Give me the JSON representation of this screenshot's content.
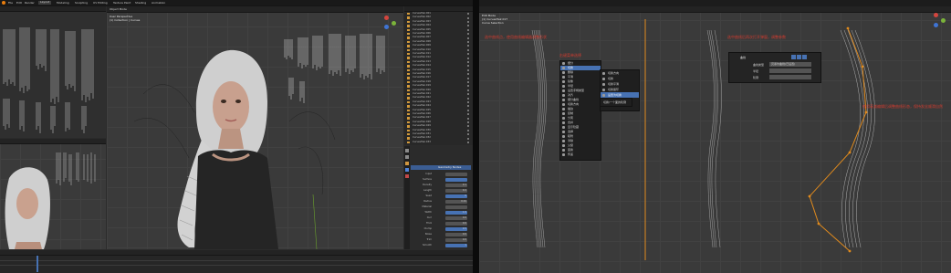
{
  "left_window": {
    "topbar": {
      "menu_items": [
        "File",
        "Edit",
        "Render",
        "Window",
        "Help"
      ],
      "active_tab": "Layout",
      "tabs": [
        "Layout",
        "Modeling",
        "Sculpting",
        "UV Editing",
        "Texture Paint",
        "Shading",
        "Animation",
        "Rendering"
      ]
    },
    "viewport": {
      "mode_label": "Object Mode",
      "view_label": "User Perspective",
      "collection_label": "(1) Collection | Curves"
    },
    "outliner": {
      "items": [
        "CurvesHair.001",
        "CurvesHair.002",
        "CurvesHair.003",
        "CurvesHair.004",
        "CurvesHair.005",
        "CurvesHair.006",
        "CurvesHair.007",
        "CurvesHair.008",
        "CurvesHair.009",
        "CurvesHair.010",
        "CurvesHair.011",
        "CurvesHair.012",
        "CurvesHair.013",
        "CurvesHair.014",
        "CurvesHair.015",
        "CurvesHair.016",
        "CurvesHair.017",
        "CurvesHair.018",
        "CurvesHair.019",
        "CurvesHair.020",
        "CurvesHair.021",
        "CurvesHair.022",
        "CurvesHair.023",
        "CurvesHair.024",
        "CurvesHair.025",
        "CurvesHair.026",
        "CurvesHair.027",
        "CurvesHair.028",
        "CurvesHair.029",
        "CurvesHair.030",
        "CurvesHair.031",
        "CurvesHair.032",
        "CurvesHair.033"
      ]
    },
    "properties": {
      "header": "Geometry Nodes",
      "rows": [
        {
          "label": "Input",
          "value": ""
        },
        {
          "label": "Surface",
          "value": ""
        },
        {
          "label": "Density",
          "value": "0.1"
        },
        {
          "label": "Length",
          "value": "0.2"
        },
        {
          "label": "Seed",
          "value": "0"
        },
        {
          "label": "Radius",
          "value": "0.01"
        },
        {
          "label": "Material",
          "value": ""
        },
        {
          "label": "Width",
          "value": "1.0"
        },
        {
          "label": "Curl",
          "value": "0.0"
        },
        {
          "label": "Frizz",
          "value": "0.0"
        },
        {
          "label": "Clump",
          "value": "0.5"
        },
        {
          "label": "Noise",
          "value": "0.0"
        },
        {
          "label": "Trim",
          "value": "0.0"
        },
        {
          "label": "Smooth",
          "value": "1"
        }
      ]
    }
  },
  "right_window": {
    "header_lines": [
      "Edit Mode",
      "(1) CurvesHair.017",
      "Curve Selection"
    ],
    "annotations": [
      "选中曲线点，使用曲线编辑器调整形状",
      "右键菜单选择",
      "选中曲线后再次打开弹窗，调整参数",
      "使用衰减编辑后调整曲线形态，保持发丝顺滑自然"
    ],
    "context_menu": {
      "items": [
        "细分",
        "切换",
        "删除",
        "平滑",
        "镜像",
        "半径",
        "设置手柄类型",
        "对齐",
        "细分曲线",
        "切换方向",
        "描边",
        "复制",
        "分离",
        "合并",
        "显示隐藏",
        "选择",
        "吸附",
        "清除",
        "父级",
        "变换",
        "传递"
      ],
      "selected": "切换"
    },
    "submenu": {
      "items": [
        "切换方向",
        "切换",
        "切换平滑",
        "切换循环",
        "设置为切换"
      ],
      "selected": "设置为切换",
      "extra": "切换/一个面的轮廓"
    },
    "popup": {
      "title": "曲线",
      "rows": [
        {
          "label": "曲线类型",
          "value": "贝塞尔曲线(已设置)"
        },
        {
          "label": "半径",
          "value": ""
        },
        {
          "label": "轮廓",
          "value": ""
        }
      ]
    }
  }
}
